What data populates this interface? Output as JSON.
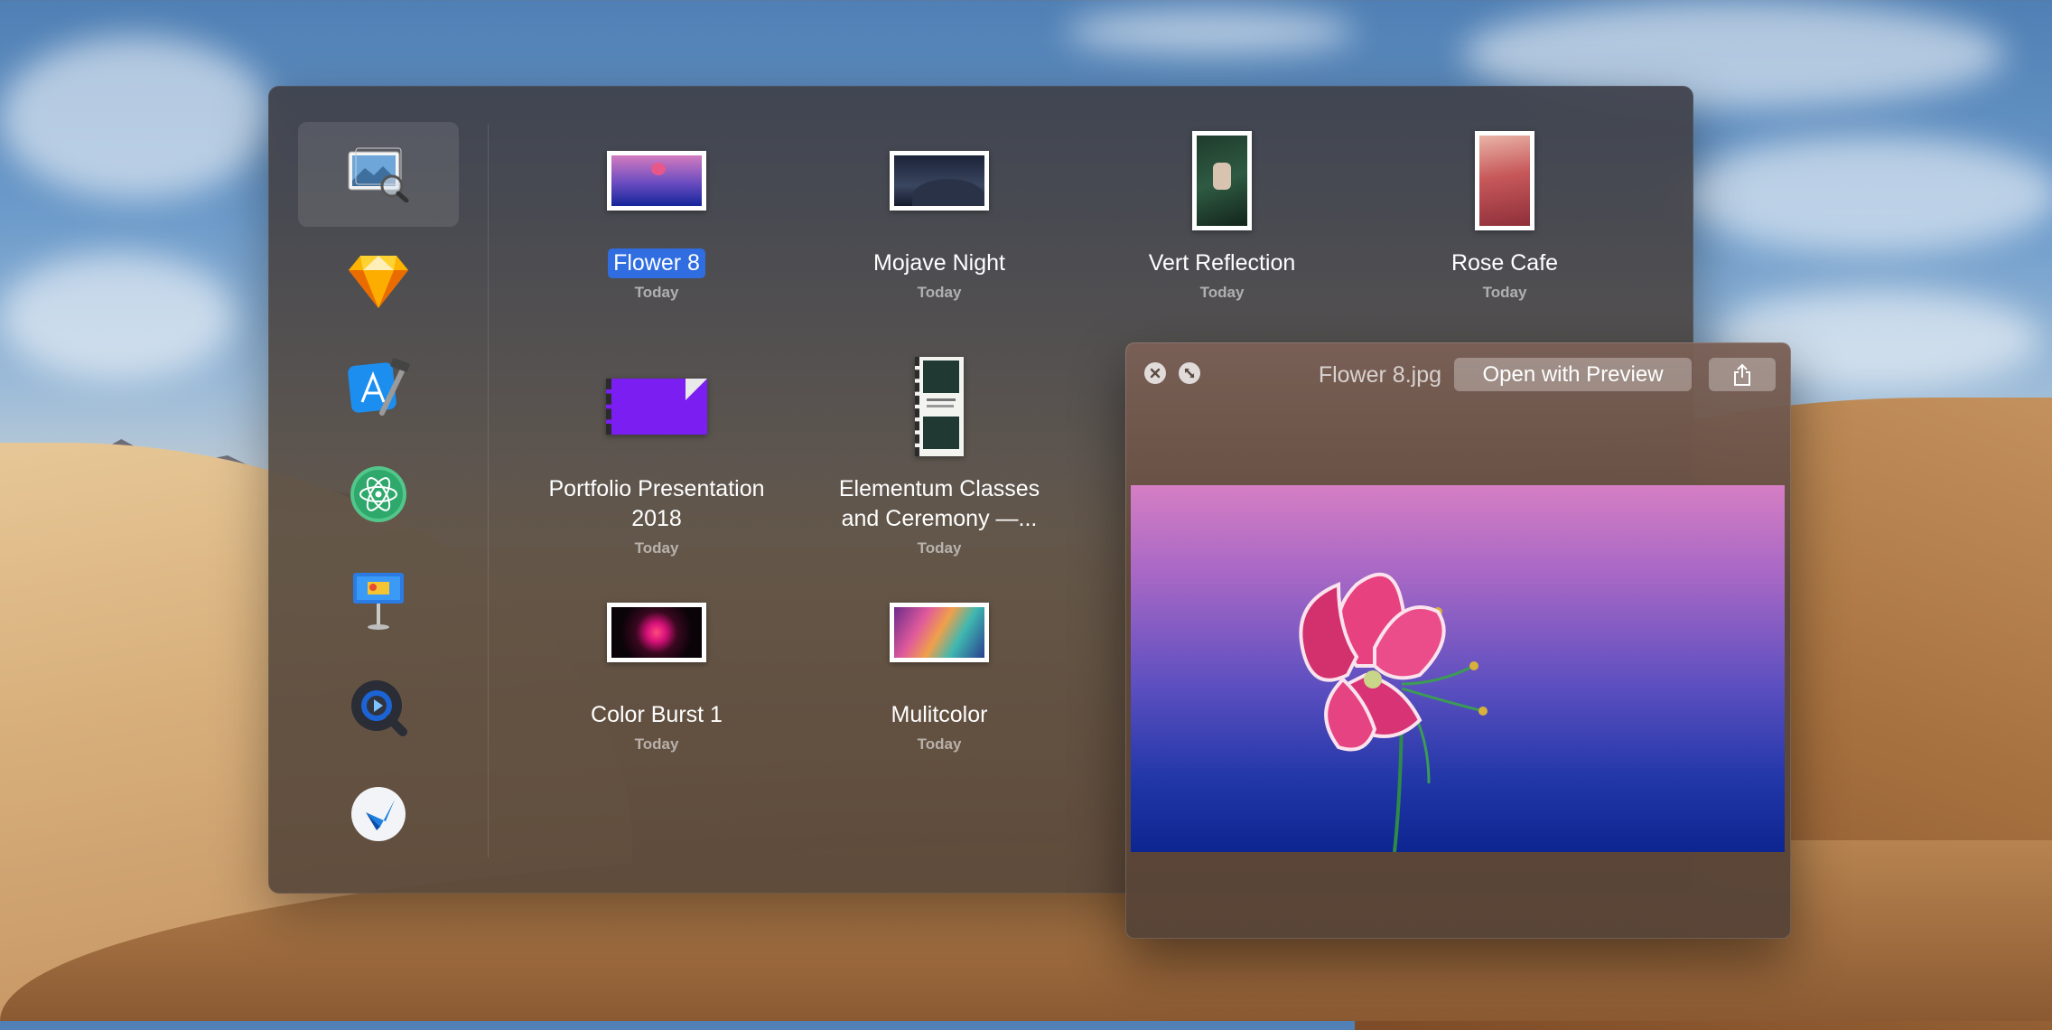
{
  "files": [
    {
      "name": "Flower 8",
      "date": "Today",
      "selected": true
    },
    {
      "name": "Mojave Night",
      "date": "Today"
    },
    {
      "name": "Vert Reflection",
      "date": "Today"
    },
    {
      "name": "Rose Cafe",
      "date": "Today"
    },
    {
      "name_line1": "Portfolio Presentation",
      "name_line2": "2018",
      "date": "Today"
    },
    {
      "name_line1": "Elementum Classes",
      "name_line2": "and Ceremony —...",
      "date": "Today"
    },
    {
      "name": "Color Burst 1",
      "date": "Today"
    },
    {
      "name": "Mulitcolor",
      "date": "Today"
    }
  ],
  "sidebar": {
    "apps": [
      {
        "icon": "preview-app-icon",
        "selected": true
      },
      {
        "icon": "sketch-app-icon"
      },
      {
        "icon": "xcode-app-icon"
      },
      {
        "icon": "atom-app-icon"
      },
      {
        "icon": "keynote-app-icon"
      },
      {
        "icon": "quicktime-app-icon"
      },
      {
        "icon": "paw-app-icon"
      }
    ]
  },
  "quicklook": {
    "title": "Flower 8.jpg",
    "open_label": "Open with Preview",
    "close_icon": "close-icon",
    "fullscreen_icon": "fullscreen-icon",
    "share_icon": "share-icon"
  },
  "colors": {
    "selection": "#2f6de0"
  }
}
